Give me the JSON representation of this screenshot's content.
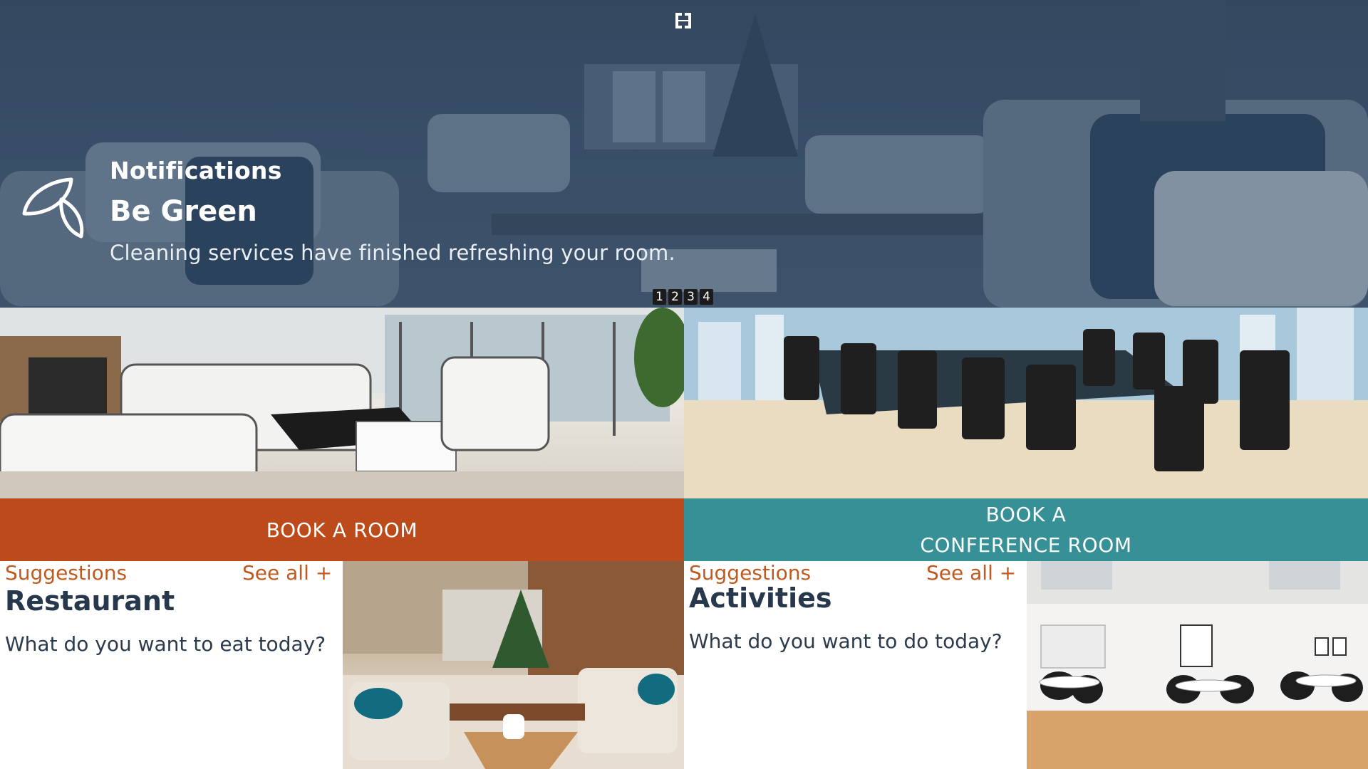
{
  "app": {
    "logo_icon": "hotel-logo-icon"
  },
  "notification": {
    "heading": "Notifications",
    "title": "Be Green",
    "message": "Cleaning services have finished refreshing your room.",
    "icon": "leaf-icon",
    "pages": [
      "1",
      "2",
      "3",
      "4"
    ]
  },
  "booking": {
    "room_label": "BOOK A ROOM",
    "conference_line1": "BOOK A",
    "conference_line2": "CONFERENCE ROOM"
  },
  "suggestions": {
    "restaurant": {
      "label": "Suggestions",
      "see_all": "See all +",
      "title": "Restaurant",
      "question": "What do you want to eat today?"
    },
    "activities": {
      "label": "Suggestions",
      "see_all": "See all +",
      "title": "Activities",
      "question": "What do you want to do today?"
    }
  },
  "colors": {
    "book_room": "#bd4a1b",
    "book_conference": "#369095",
    "accent_text": "#c25a20",
    "hero_overlay": "#3b4f66"
  }
}
